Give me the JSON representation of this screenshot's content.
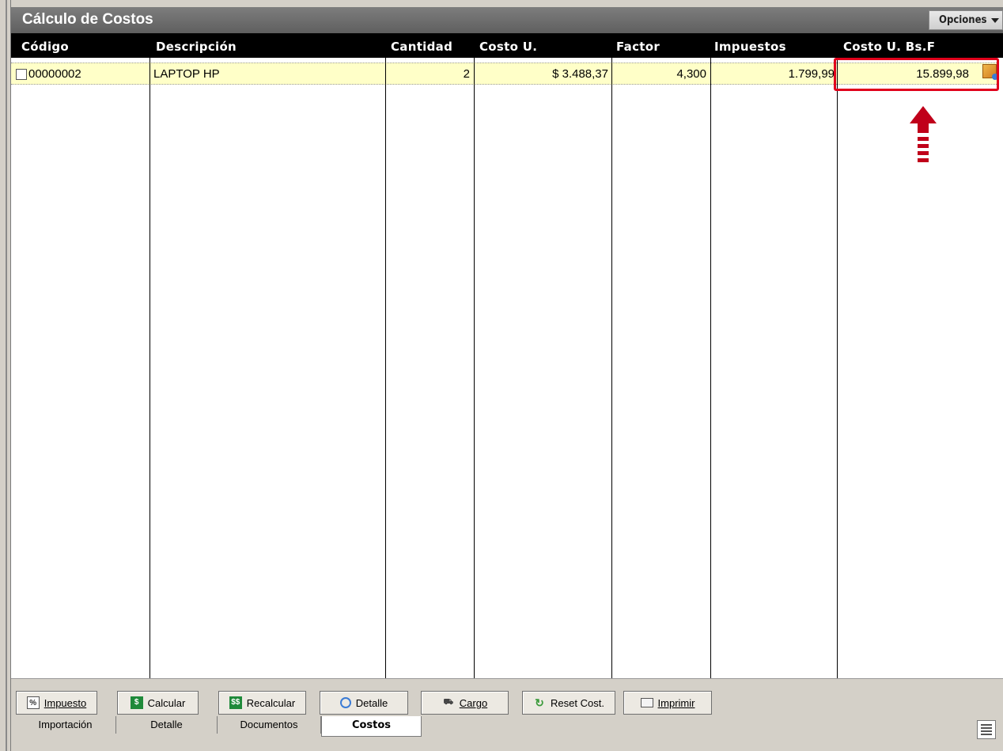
{
  "window": {
    "title": "Cálculo de Costos",
    "options_label": "Opciones"
  },
  "columns": [
    "Código",
    "Descripción",
    "Cantidad",
    "Costo U.",
    "Factor",
    "Impuestos",
    "Costo U. Bs.F"
  ],
  "rows": [
    {
      "codigo": "00000002",
      "descripcion": "LAPTOP HP",
      "cantidad": "2",
      "costo_u": "$ 3.488,37",
      "factor": "4,300",
      "impuestos": "1.799,99",
      "costo_bsf": "15.899,98"
    }
  ],
  "toolbar": {
    "impuesto": "Impuesto",
    "calcular": "Calcular",
    "recalcular": "Recalcular",
    "detalle": "Detalle",
    "cargo": "Cargo",
    "reset": "Reset Cost.",
    "imprimir": "Imprimir"
  },
  "tabs": [
    "Importación",
    "Detalle",
    "Documentos",
    "Costos"
  ],
  "active_tab": "Costos",
  "colors": {
    "row_highlight": "#ffffc8",
    "annotation": "#e0001b",
    "header_bg": "#000000"
  },
  "icons": {
    "options": "chevron-down-icon",
    "row_action": "edit-cost-icon",
    "annotation": "up-arrow-icon"
  }
}
